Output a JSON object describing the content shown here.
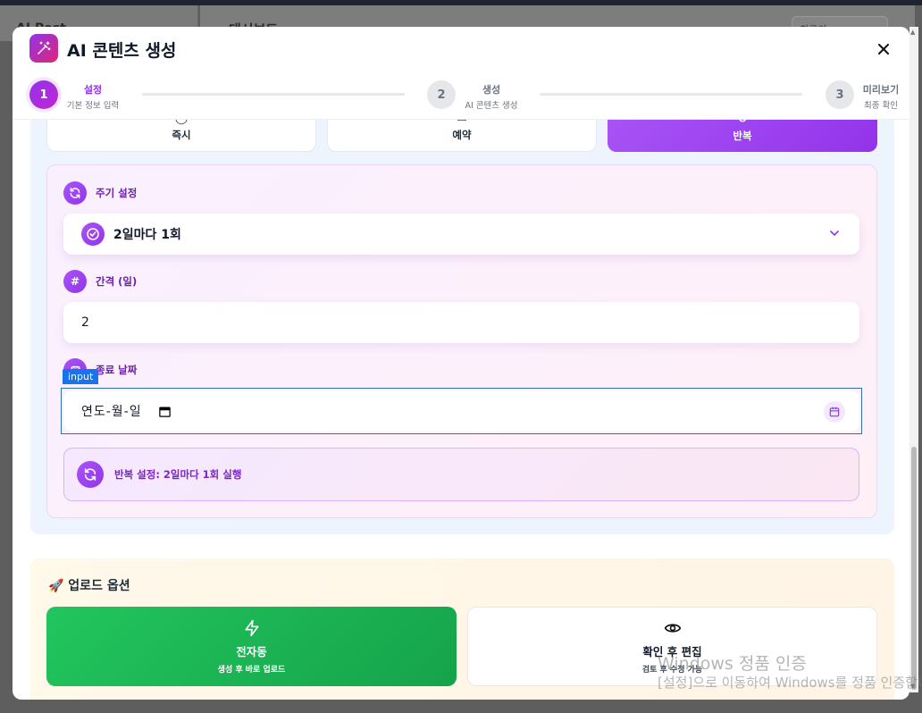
{
  "background": {
    "sidebar_text": "AI Post",
    "header_title": "대시보드",
    "search_placeholder": "최근의"
  },
  "modal": {
    "title": "AI 콘텐츠 생성",
    "steps": [
      {
        "number": "1",
        "title": "설정",
        "subtitle": "기본 정보 입력",
        "state": "active"
      },
      {
        "number": "2",
        "title": "생성",
        "subtitle": "AI 콘텐츠 생성",
        "state": "inactive"
      },
      {
        "number": "3",
        "title": "미리보기",
        "subtitle": "최종 확인",
        "state": "inactive"
      }
    ]
  },
  "schedule": {
    "modes": [
      {
        "label": "즉시",
        "icon": "clock-icon",
        "active": false
      },
      {
        "label": "예약",
        "icon": "calendar-icon",
        "active": false
      },
      {
        "label": "반복",
        "icon": "repeat-icon",
        "active": true
      }
    ],
    "cycle": {
      "label": "주기 설정",
      "value": "2일마다 1회"
    },
    "interval": {
      "label": "간격 (일)",
      "value": "2"
    },
    "end_date": {
      "label": "종료 날짜",
      "placeholder": "연도-월-일",
      "inspect_tag": "input"
    },
    "summary": "반복 설정: 2일마다 1회 실행"
  },
  "upload": {
    "title": "🚀 업로드 옵션",
    "options": [
      {
        "title": "전자동",
        "subtitle": "생성 후 바로 업로드",
        "selected": true
      },
      {
        "title": "확인 후 편집",
        "subtitle": "검토 후 수정 가능",
        "selected": false
      }
    ]
  },
  "watermark": {
    "line1": "Windows 정품 인증",
    "line2": "[설정]으로 이동하여 Windows를 정품 인증합니다."
  },
  "colors": {
    "accent_purple": "#9333ea",
    "accent_pink": "#db2777",
    "success_green": "#16a34a"
  }
}
